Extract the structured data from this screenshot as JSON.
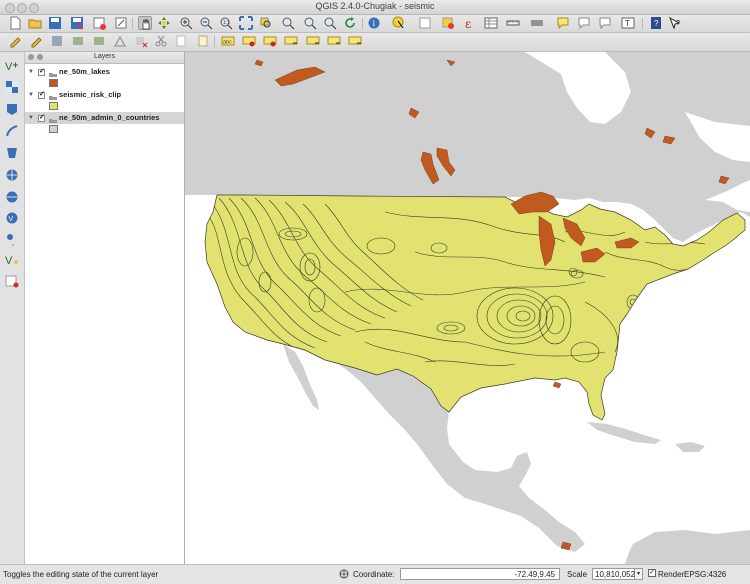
{
  "window": {
    "title": "QGIS 2.4.0-Chugiak - seismic"
  },
  "toolbar_top": {
    "icons": [
      "new-project-icon",
      "open-project-icon",
      "save-project-icon",
      "save-as-icon",
      "new-print-composer-icon",
      "composer-manager-icon",
      "pan-icon",
      "pan-to-selection-icon",
      "zoom-in-icon",
      "zoom-out-icon",
      "zoom-actual-icon",
      "zoom-full-icon",
      "zoom-to-selection-icon",
      "zoom-to-layer-icon",
      "zoom-last-icon",
      "zoom-next-icon",
      "refresh-icon",
      "identify-icon",
      "select-icon",
      "deselect-icon",
      "expression-select-icon",
      "field-calculator-icon",
      "attribute-table-icon",
      "measure-icon",
      "statistics-icon",
      "annotation-icon",
      "tips-icon",
      "text-annotation-icon",
      "label-icon",
      "help-icon",
      "whats-this-icon"
    ]
  },
  "toolbar_edit": {
    "icons": [
      "current-edits-icon",
      "toggle-editing-icon",
      "save-edits-icon",
      "add-feature-icon",
      "move-feature-icon",
      "node-tool-icon",
      "delete-selected-icon",
      "cut-features-icon",
      "copy-features-icon",
      "paste-features-icon",
      "layer-labeling-icon",
      "label-pin-icon",
      "label-show-hide-icon",
      "label-move-icon",
      "label-rotate-icon",
      "label-change-icon"
    ]
  },
  "left_toolbar": {
    "icons": [
      "add-vector-layer-icon",
      "add-raster-layer-icon",
      "add-postgis-layer-icon",
      "add-spatialite-layer-icon",
      "add-mssql-layer-icon",
      "add-wms-layer-icon",
      "add-wcs-layer-icon",
      "add-wfs-layer-icon",
      "add-delimited-text-icon",
      "new-shapefile-icon",
      "remove-layer-icon"
    ]
  },
  "layers_panel": {
    "title": "Layers",
    "layers": [
      {
        "name": "ne_50m_lakes",
        "checked": true,
        "swatch": "#c0561b"
      },
      {
        "name": "seismic_risk_clip",
        "checked": true,
        "swatch": "#e1e36d"
      },
      {
        "name": "ne_50m_admin_0_countries",
        "checked": true,
        "swatch": "#cfcfcf",
        "selected": true
      }
    ]
  },
  "map": {
    "colors": {
      "land": "#d0d0d0",
      "ocean": "#ffffff",
      "seismic": "#e2e270",
      "lakes": "#c15a1e",
      "contour": "#3a3a22"
    }
  },
  "statusbar": {
    "message": "Toggles the editing state of the current layer",
    "coordinate_label": "Coordinate:",
    "coordinate_value": "-72.49,9.45",
    "scale_label": "Scale",
    "scale_value": "10,810,052",
    "render_label": "Render",
    "render_checked": true,
    "epsg": "EPSG:4326"
  }
}
